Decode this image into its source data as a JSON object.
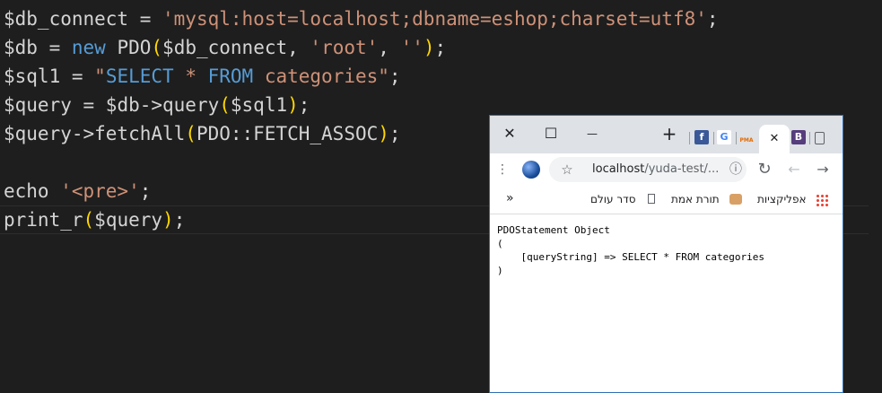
{
  "editor": {
    "lines": [
      [
        [
          "v2",
          "$db_connect"
        ],
        [
          "v2",
          " = "
        ],
        [
          "s",
          "'mysql:host=localhost;dbname=eshop;charset=utf8'"
        ],
        [
          "v2",
          ";"
        ]
      ],
      [
        [
          "v2",
          "$db"
        ],
        [
          "v2",
          " = "
        ],
        [
          "kw",
          "new"
        ],
        [
          "v2",
          " PDO"
        ],
        [
          "br",
          "("
        ],
        [
          "v2",
          "$db_connect, "
        ],
        [
          "s",
          "'root'"
        ],
        [
          "v2",
          ", "
        ],
        [
          "s",
          "''"
        ],
        [
          "br",
          ")"
        ],
        [
          "v2",
          ";"
        ]
      ],
      [
        [
          "v2",
          "$sql1"
        ],
        [
          "v2",
          " = "
        ],
        [
          "s",
          "\""
        ],
        [
          "kw",
          "SELECT"
        ],
        [
          "s",
          " * "
        ],
        [
          "kw",
          "FROM"
        ],
        [
          "s",
          " categories\""
        ],
        [
          "v2",
          ";"
        ]
      ],
      [
        [
          "v2",
          "$query"
        ],
        [
          "v2",
          " = "
        ],
        [
          "v2",
          "$db->query"
        ],
        [
          "br",
          "("
        ],
        [
          "v2",
          "$sql1"
        ],
        [
          "br",
          ")"
        ],
        [
          "v2",
          ";"
        ]
      ],
      [
        [
          "v2",
          "$query->fetchAll"
        ],
        [
          "br",
          "("
        ],
        [
          "v2",
          "PDO::FETCH_ASSOC"
        ],
        [
          "br",
          ")"
        ],
        [
          "v2",
          ";"
        ]
      ],
      [],
      [
        [
          "v2",
          "echo "
        ],
        [
          "s",
          "'<pre>'"
        ],
        [
          "v2",
          ";"
        ]
      ],
      [
        [
          "v2",
          "print_r"
        ],
        [
          "br",
          "("
        ],
        [
          "v2",
          "$query"
        ],
        [
          "br",
          ")"
        ],
        [
          "v2",
          ";"
        ]
      ]
    ]
  },
  "browser": {
    "window_controls": {
      "close": "✕",
      "maximize": "☐",
      "minimize": "—"
    },
    "tabs": {
      "new_tab": "+",
      "facebook_letter": "f",
      "google_letter": "G",
      "pma_label": "PMA",
      "active_close": "✕",
      "bootstrap_letter": "B"
    },
    "address": {
      "host": "localhost",
      "path": "/yuda-test/..."
    },
    "bookmarks": {
      "overflow": "»",
      "item1": "סדר עולם",
      "item2": "תורת אמת",
      "apps": "אפליקציות"
    },
    "page_content": "PDOStatement Object\n(\n    [queryString] => SELECT * FROM categories\n)"
  },
  "colors": {
    "editor_bg": "#1e1e1e",
    "string": "#ce9178",
    "keyword": "#569cd6",
    "bracket": "#ffd700",
    "text": "#d4d4d4",
    "browser_border": "#2f6fb5"
  }
}
